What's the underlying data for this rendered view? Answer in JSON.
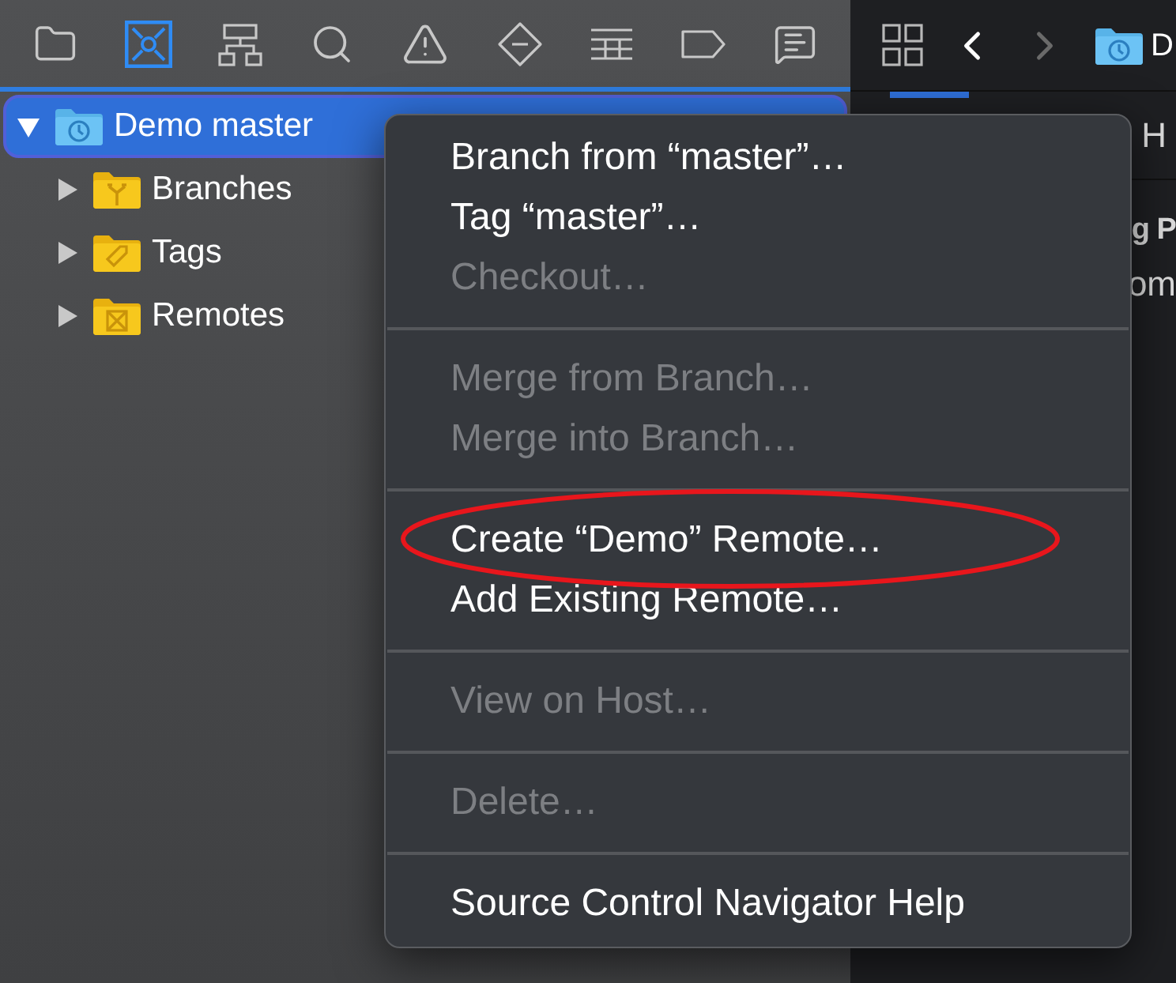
{
  "navigator_toolbar": [
    {
      "kind": "folder",
      "selected": false
    },
    {
      "kind": "source-control",
      "selected": true
    },
    {
      "kind": "hierarchy",
      "selected": false
    },
    {
      "kind": "search",
      "selected": false
    },
    {
      "kind": "warning",
      "selected": false
    },
    {
      "kind": "test",
      "selected": false
    },
    {
      "kind": "list",
      "selected": false
    },
    {
      "kind": "tag",
      "selected": false
    },
    {
      "kind": "message",
      "selected": false
    }
  ],
  "tree": [
    {
      "label": "Demo master",
      "kind": "repo",
      "expanded": true,
      "selected": true,
      "children": [
        {
          "label": "Branches",
          "kind": "branches",
          "expanded": false,
          "selected": false
        },
        {
          "label": "Tags",
          "kind": "tags",
          "expanded": false,
          "selected": false
        },
        {
          "label": "Remotes",
          "kind": "remotes",
          "expanded": false,
          "selected": false
        }
      ]
    }
  ],
  "editor": {
    "path_start": "D",
    "forward_disabled": true,
    "text_1": "H",
    "heading": "g P",
    "text_2": "om"
  },
  "context_menu": {
    "groups": [
      [
        {
          "label": "Branch from “master”…",
          "disabled": false
        },
        {
          "label": "Tag “master”…",
          "disabled": false
        },
        {
          "label": "Checkout…",
          "disabled": true
        }
      ],
      [
        {
          "label": "Merge from Branch…",
          "disabled": true
        },
        {
          "label": "Merge into Branch…",
          "disabled": true
        }
      ],
      [
        {
          "label": "Create “Demo” Remote…",
          "disabled": false,
          "circled": true
        },
        {
          "label": "Add Existing Remote…",
          "disabled": false
        }
      ],
      [
        {
          "label": "View on Host…",
          "disabled": true
        }
      ],
      [
        {
          "label": "Delete…",
          "disabled": true
        }
      ],
      [
        {
          "label": "Source Control Navigator Help",
          "disabled": false
        }
      ]
    ]
  }
}
